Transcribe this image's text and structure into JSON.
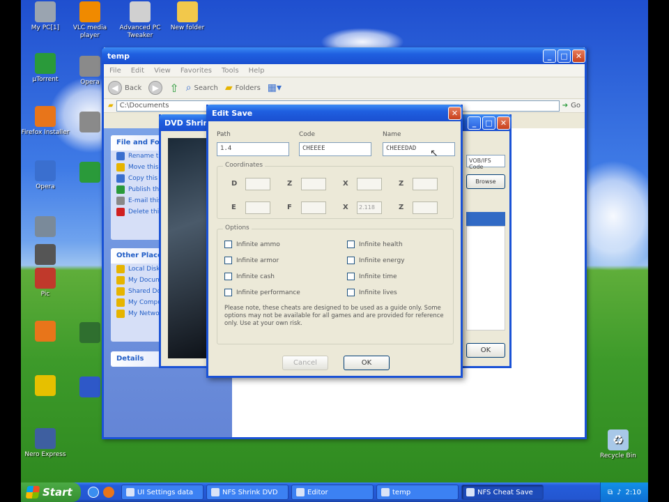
{
  "desktop": {
    "icons_left": [
      {
        "label": "My PC[1]",
        "icon": "computer-icon",
        "color": "#9aa4b0"
      },
      {
        "label": "µTorrent",
        "icon": "utorrent-icon",
        "color": "#2a9a3a"
      },
      {
        "label": "Firefox Installer",
        "icon": "firefox-icon",
        "color": "#e8751a"
      },
      {
        "label": "Opera",
        "icon": "blue-app-icon",
        "color": "#3a6fcf"
      },
      {
        "label": "",
        "icon": "tools-icon",
        "color": "#7a8a9a"
      },
      {
        "label": "",
        "icon": "car-icon",
        "color": "#555555"
      },
      {
        "label": "Pic",
        "icon": "picture-icon",
        "color": "#c0392b"
      },
      {
        "label": "",
        "icon": "firefox-icon",
        "color": "#e8751a"
      },
      {
        "label": "",
        "icon": "disc-icon",
        "color": "#e6c000"
      },
      {
        "label": "Nero Express",
        "icon": "floppy-icon",
        "color": "#3e5fa0"
      }
    ],
    "icons_col2": [
      {
        "label": "VLC media player",
        "icon": "vlc-icon",
        "color": "#f08a00"
      },
      {
        "label": "Opera",
        "icon": "audio-icon",
        "color": "#8a8a8a"
      },
      {
        "label": "",
        "icon": "audio-icon",
        "color": "#8a8a8a"
      },
      {
        "label": "",
        "icon": "utorrent-icon",
        "color": "#2a9a3a"
      },
      {
        "label": "",
        "icon": "game-icon",
        "color": "#2f6f2f"
      },
      {
        "label": "",
        "icon": "blue-app-icon",
        "color": "#2e58c8"
      }
    ],
    "icons_col3": [
      {
        "label": "Advanced PC Tweaker",
        "icon": "tweaker-icon",
        "color": "#d0d0d0"
      }
    ],
    "icons_col4": [
      {
        "label": "New folder",
        "icon": "folder-icon",
        "color": "#f2c84b"
      }
    ],
    "recycle_bin": {
      "label": "Recycle Bin",
      "icon": "recycle-bin-icon",
      "color": "#a8c8e8"
    }
  },
  "explorer": {
    "title": "temp",
    "menu": [
      "File",
      "Edit",
      "View",
      "Favorites",
      "Tools",
      "Help"
    ],
    "toolbar": {
      "back": "Back",
      "search": "Search",
      "folders": "Folders"
    },
    "address": "C:\\Documents",
    "go": "Go",
    "taskpane": {
      "tasks_title": "File and Folder Tasks",
      "tasks": [
        "Rename this file",
        "Move this file",
        "Copy this file",
        "Publish this file",
        "E-mail this file",
        "Delete this file"
      ],
      "places_title": "Other Places",
      "places": [
        "Local Disk",
        "My Documents",
        "Shared Documents",
        "My Computer",
        "My Network Places"
      ],
      "details_title": "Details"
    }
  },
  "dvdshrink": {
    "title": "DVD Shrink 3.2",
    "fields": [
      "VOB/IFS Code",
      "Browse"
    ],
    "ok": "OK"
  },
  "dialog": {
    "title": "Edit Save",
    "labels": {
      "path": "Path",
      "code": "Code",
      "name": "Name"
    },
    "values": {
      "path": "1.4",
      "code": "CHEEEE",
      "name": "CHEEEDAD"
    },
    "coord_group": "Coordinates",
    "coords": [
      {
        "label": "D",
        "value": ""
      },
      {
        "label": "Z",
        "value": ""
      },
      {
        "label": "X",
        "value": ""
      },
      {
        "label": "Z",
        "value": ""
      },
      {
        "label": "E",
        "value": ""
      },
      {
        "label": "F",
        "value": ""
      },
      {
        "label": "X",
        "value": "2.118"
      },
      {
        "label": "Z",
        "value": ""
      }
    ],
    "options_group": "Options",
    "options_left": [
      "Infinite ammo",
      "Infinite armor",
      "Infinite cash",
      "Infinite performance"
    ],
    "options_right": [
      "Infinite health",
      "Infinite energy",
      "Infinite time",
      "Infinite lives"
    ],
    "note": "Please note, these cheats are designed to be used as a guide only. Some options may not be available for all games and are provided for reference only. Use at your own risk.",
    "buttons": {
      "cancel": "Cancel",
      "ok": "OK"
    }
  },
  "taskbar": {
    "start": "Start",
    "tasks": [
      "UI Settings data",
      "NFS Shrink DVD",
      "Editor",
      "temp",
      "NFS Cheat Save"
    ],
    "clock": "2:10"
  }
}
